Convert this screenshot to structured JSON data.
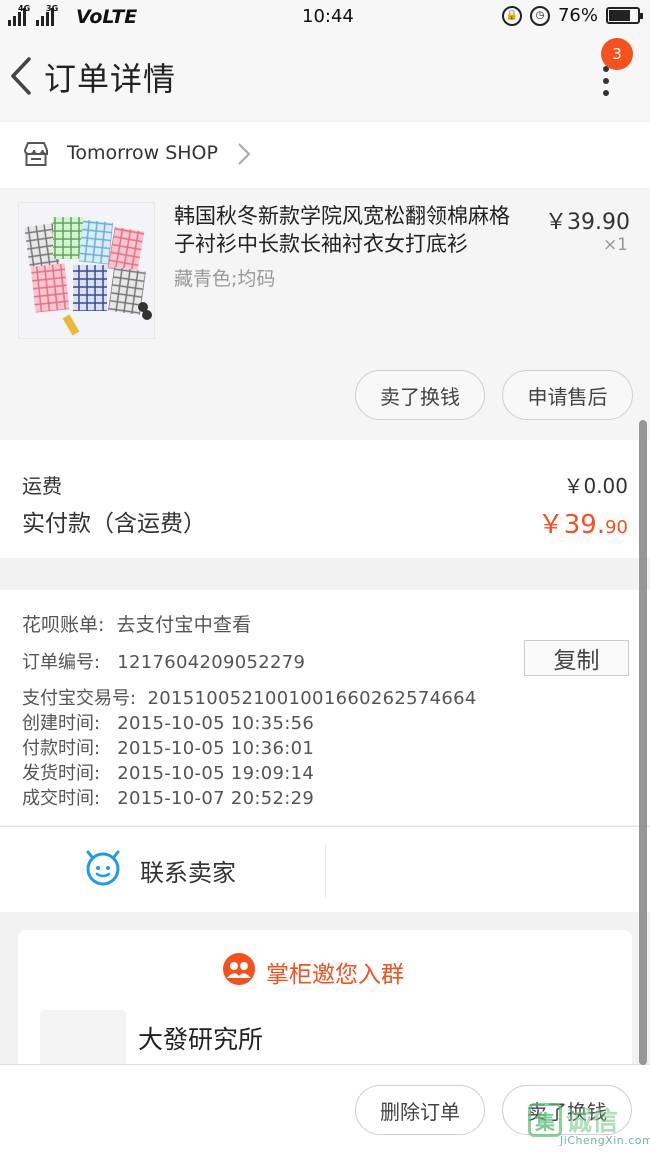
{
  "status_bar": {
    "net_a": "4G",
    "net_b": "3G",
    "volte": "VoLTE",
    "time": "10:44",
    "battery": "76%",
    "battery_level": 0.76
  },
  "header": {
    "title": "订单详情",
    "badge_count": "3"
  },
  "shop": {
    "name": "Tomorrow SHOP"
  },
  "product": {
    "title": "韩国秋冬新款学院风宽松翻领棉麻格子衬衫中长款长袖衬衣女打底衫",
    "variant": "藏青色;均码",
    "price": "￥39.90",
    "qty": "×1",
    "actions": [
      "卖了换钱",
      "申请售后"
    ]
  },
  "fees": {
    "shipping_label": "运费",
    "shipping_value": "￥0.00",
    "paid_label": "实付款（含运费）",
    "paid_value_main": "￥39.",
    "paid_value_cents": "90"
  },
  "order_info": {
    "huabei_label": "花呗账单:",
    "huabei_value": "去支付宝中查看",
    "order_no_label": "订单编号:",
    "order_no_value": "1217604209052279",
    "copy_label": "复制",
    "alipay_label": "支付宝交易号:",
    "alipay_value": "2015100521001001660262574664",
    "created_label": "创建时间:",
    "created_value": "2015-10-05 10:35:56",
    "paid_label": "付款时间:",
    "paid_value": "2015-10-05 10:36:01",
    "shipped_label": "发货时间:",
    "shipped_value": "2015-10-05 19:09:14",
    "done_label": "成交时间:",
    "done_value": "2015-10-07 20:52:29"
  },
  "contact": {
    "label": "联系卖家"
  },
  "invite": {
    "title": "掌柜邀您入群",
    "group_name": "大發研究所"
  },
  "bottom_bar": {
    "delete_label": "删除订单",
    "sell_label": "卖了换钱"
  },
  "watermark": {
    "logo": "集",
    "text": "诚信",
    "sub": "JiChengXin.com"
  },
  "colors": {
    "accent": "#f4511e",
    "contact_icon": "#1e9be8"
  }
}
